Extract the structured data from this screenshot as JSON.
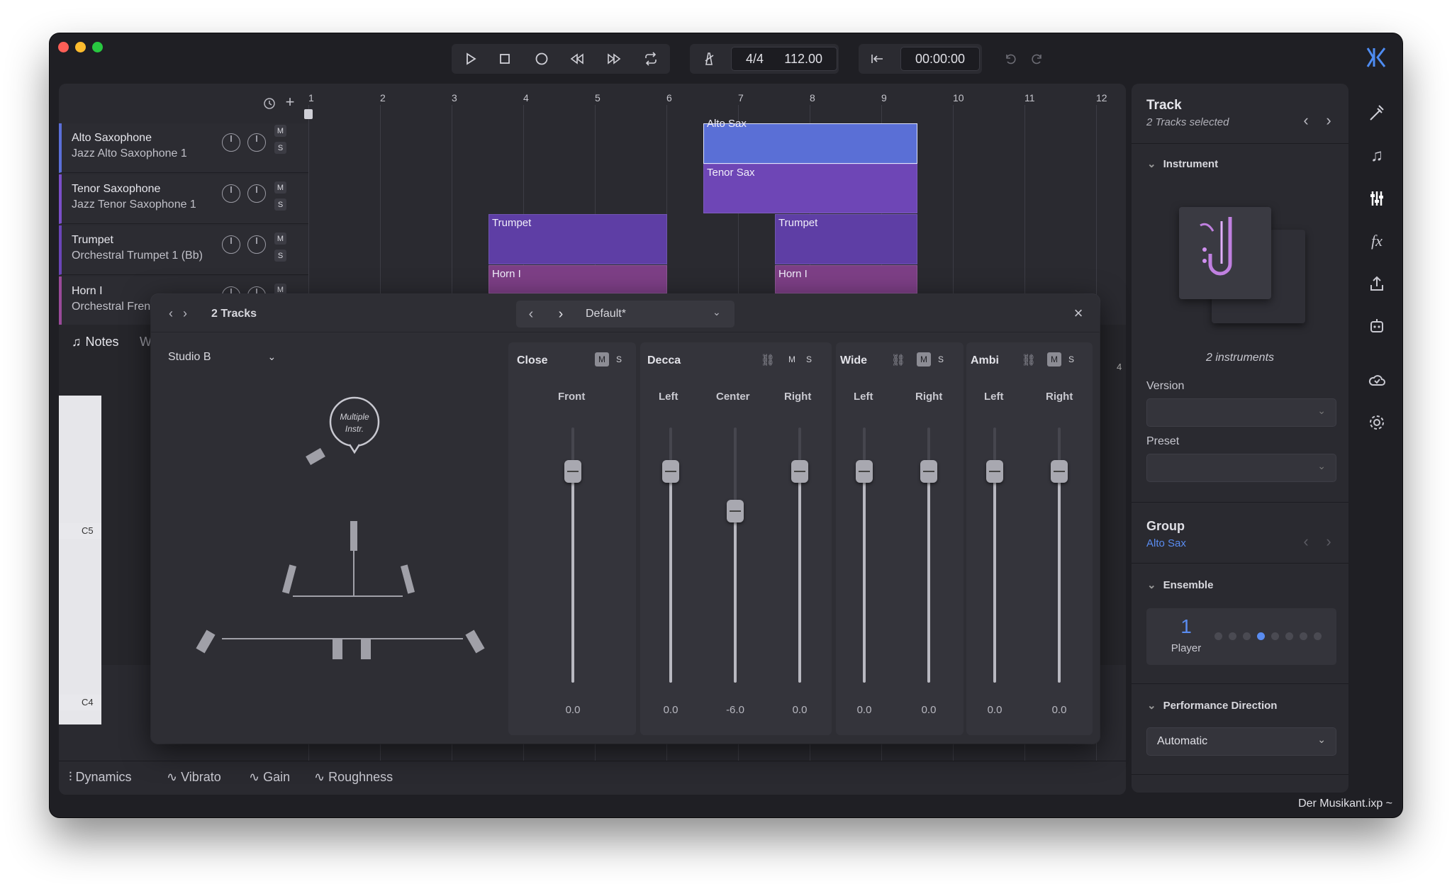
{
  "transport": {
    "time_signature": "4/4",
    "tempo": "112.00",
    "time": "00:00:00"
  },
  "tracks": [
    {
      "name": "Alto Saxophone",
      "instrument": "Jazz Alto Saxophone 1",
      "color": "#5b6fd8"
    },
    {
      "name": "Tenor Saxophone",
      "instrument": "Jazz Tenor Saxophone 1",
      "color": "#7b4fc9"
    },
    {
      "name": "Trumpet",
      "instrument": "Orchestral Trumpet 1 (Bb)",
      "color": "#6a45b8"
    },
    {
      "name": "Horn I",
      "instrument": "Orchestral French",
      "color": "#9a4a9a"
    }
  ],
  "ms": {
    "m": "M",
    "s": "S"
  },
  "ruler": [
    "1",
    "2",
    "3",
    "4",
    "5",
    "6",
    "7",
    "8",
    "9",
    "10",
    "11",
    "12"
  ],
  "regions": {
    "alto": "Alto Sax",
    "tenor": "Tenor Sax",
    "trumpet1": "Trumpet",
    "trumpet2": "Trumpet",
    "horn1": "Horn I",
    "horn2": "Horn I"
  },
  "bottom_tabs": [
    "Notes",
    "W"
  ],
  "piano": {
    "c5": "C5",
    "c4": "C4",
    "bar14": "4"
  },
  "automation": [
    "Dynamics",
    "Vibrato",
    "Gain",
    "Roughness"
  ],
  "dialog": {
    "title": "2 Tracks",
    "preset": "Default*",
    "room": "Studio B",
    "bubble": "Multiple Instr.",
    "groups": [
      {
        "name": "Close",
        "channels": [
          {
            "label": "Front",
            "value": "0.0"
          }
        ]
      },
      {
        "name": "Decca",
        "channels": [
          {
            "label": "Left",
            "value": "0.0"
          },
          {
            "label": "Center",
            "value": "-6.0"
          },
          {
            "label": "Right",
            "value": "0.0"
          }
        ]
      },
      {
        "name": "Wide",
        "channels": [
          {
            "label": "Left",
            "value": "0.0"
          },
          {
            "label": "Right",
            "value": "0.0"
          }
        ]
      },
      {
        "name": "Ambi",
        "channels": [
          {
            "label": "Left",
            "value": "0.0"
          },
          {
            "label": "Right",
            "value": "0.0"
          }
        ]
      }
    ]
  },
  "inspector": {
    "title": "Track",
    "subtitle": "2 Tracks selected",
    "instrument_header": "Instrument",
    "instrument_count": "2 instruments",
    "version_label": "Version",
    "preset_label": "Preset",
    "group_title": "Group",
    "group_value": "Alto Sax",
    "ensemble_header": "Ensemble",
    "player_count": "1",
    "player_label": "Player",
    "perf_header": "Performance Direction",
    "perf_value": "Automatic"
  },
  "footer": {
    "filename": "Der Musikant.ixp ~"
  },
  "colors": {
    "accent": "#5a8cf0",
    "alto": "#5a6fd6",
    "tenor": "#6e46b6",
    "horn": "#7d3f86"
  }
}
